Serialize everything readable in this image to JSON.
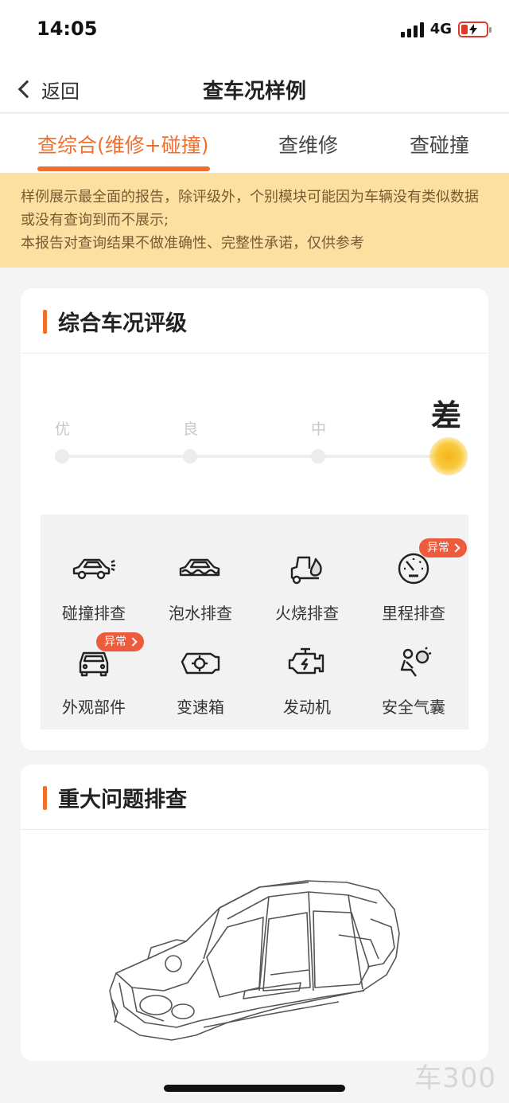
{
  "status": {
    "time": "14:05",
    "network": "4G"
  },
  "nav": {
    "back_label": "返回",
    "title": "查车况样例"
  },
  "tabs": [
    {
      "label": "查综合(维修+碰撞)",
      "active": true
    },
    {
      "label": "查维修",
      "active": false
    },
    {
      "label": "查碰撞",
      "active": false
    }
  ],
  "notice": {
    "line1": "样例展示最全面的报告，除评级外，个别模块可能因为车辆没有类似数据或没有查询到而不展示;",
    "line2": "本报告对查询结果不做准确性、完整性承诺，仅供参考"
  },
  "rating_card": {
    "title": "综合车况评级",
    "levels": [
      "优",
      "良",
      "中",
      "差"
    ],
    "current": "差"
  },
  "checks": [
    {
      "label": "碰撞排查",
      "icon": "car-crash-icon",
      "badge": ""
    },
    {
      "label": "泡水排查",
      "icon": "car-water-icon",
      "badge": ""
    },
    {
      "label": "火烧排查",
      "icon": "car-fire-icon",
      "badge": ""
    },
    {
      "label": "里程排查",
      "icon": "odometer-icon",
      "badge": "异常"
    },
    {
      "label": "外观部件",
      "icon": "car-front-icon",
      "badge": "异常"
    },
    {
      "label": "变速箱",
      "icon": "gearbox-icon",
      "badge": ""
    },
    {
      "label": "发动机",
      "icon": "engine-icon",
      "badge": ""
    },
    {
      "label": "安全气囊",
      "icon": "airbag-icon",
      "badge": ""
    }
  ],
  "major_card": {
    "title": "重大问题排查"
  },
  "watermark": "车300",
  "colors": {
    "accent": "#ef6f2e",
    "notice_bg": "#fbe0a2",
    "badge": "#ee5a3c"
  }
}
